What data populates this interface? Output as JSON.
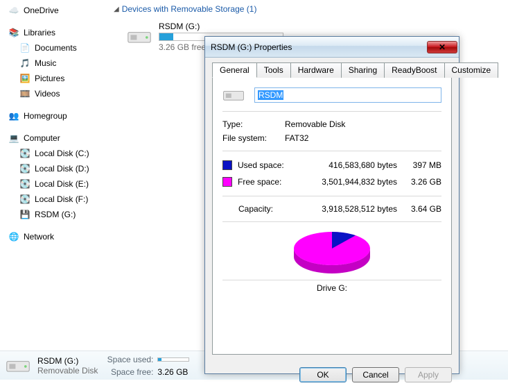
{
  "sidebar": {
    "onedrive": "OneDrive",
    "libraries": "Libraries",
    "lib_items": [
      "Documents",
      "Music",
      "Pictures",
      "Videos"
    ],
    "homegroup": "Homegroup",
    "computer": "Computer",
    "drives": [
      "Local Disk (C:)",
      "Local Disk (D:)",
      "Local Disk (E:)",
      "Local Disk (F:)",
      "RSDM (G:)"
    ],
    "network": "Network"
  },
  "content": {
    "section_title": "Devices with Removable Storage (1)",
    "drive": {
      "name": "RSDM (G:)",
      "sub": "3.26 GB free",
      "fill_pct": 11
    }
  },
  "statusbar": {
    "name": "RSDM (G:)",
    "type": "Removable Disk",
    "used_label": "Space used:",
    "free_label": "Space free:",
    "free_value": "3.26 GB",
    "used_pct": 11
  },
  "dialog": {
    "title": "RSDM (G:) Properties",
    "tabs": [
      "General",
      "Tools",
      "Hardware",
      "Sharing",
      "ReadyBoost",
      "Customize"
    ],
    "active_tab": 0,
    "name_value": "RSDM",
    "type_label": "Type:",
    "type_value": "Removable Disk",
    "fs_label": "File system:",
    "fs_value": "FAT32",
    "used": {
      "label": "Used space:",
      "bytes": "416,583,680 bytes",
      "human": "397 MB",
      "color": "#0a12c4"
    },
    "free": {
      "label": "Free space:",
      "bytes": "3,501,944,832 bytes",
      "human": "3.26 GB",
      "color": "#ff00ff"
    },
    "capacity": {
      "label": "Capacity:",
      "bytes": "3,918,528,512 bytes",
      "human": "3.64 GB"
    },
    "drive_label": "Drive G:",
    "buttons": {
      "ok": "OK",
      "cancel": "Cancel",
      "apply": "Apply"
    }
  },
  "chart_data": {
    "type": "pie",
    "title": "Drive G:",
    "series": [
      {
        "name": "Used space",
        "value": 416583680,
        "human": "397 MB",
        "color": "#0a12c4"
      },
      {
        "name": "Free space",
        "value": 3501944832,
        "human": "3.26 GB",
        "color": "#ff00ff"
      }
    ],
    "total": 3918528512
  }
}
